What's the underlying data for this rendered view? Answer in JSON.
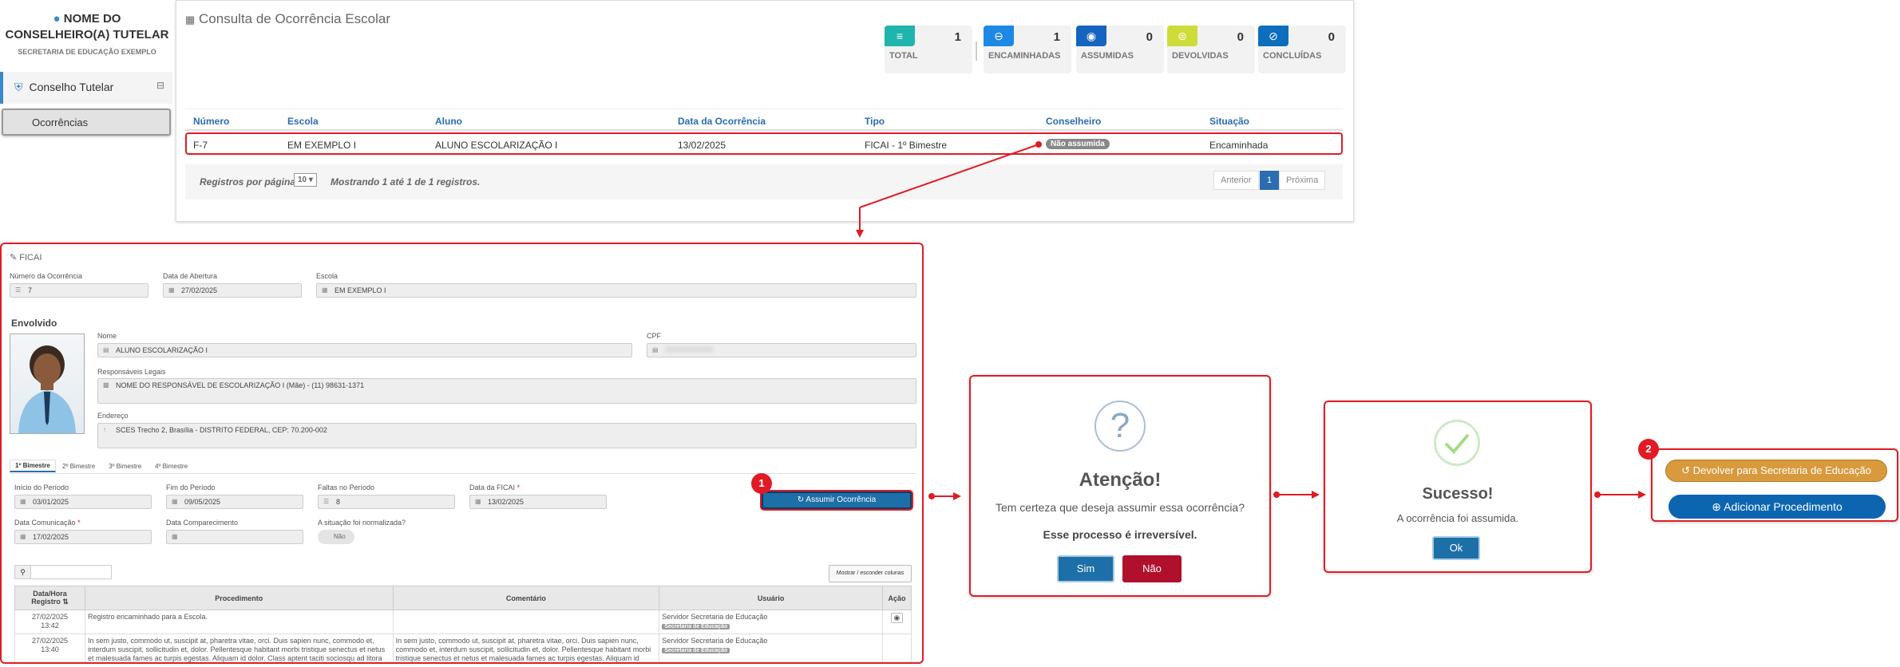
{
  "sidebar": {
    "user_name": "NOME DO CONSELHEIRO(A) TUTELAR",
    "secretaria": "SECRETARIA DE EDUCAÇÃO EXEMPLO",
    "menu": "Conselho Tutelar",
    "submenu": "Ocorrências"
  },
  "header": {
    "title": "Consulta de Ocorrência Escolar"
  },
  "stats": [
    {
      "label": "TOTAL",
      "value": "1",
      "color": "#1fb5ac"
    },
    {
      "label": "ENCAMINHADAS",
      "value": "1",
      "color": "#1e88e5"
    },
    {
      "label": "ASSUMIDAS",
      "value": "0",
      "color": "#1565c0"
    },
    {
      "label": "DEVOLVIDAS",
      "value": "0",
      "color": "#cddc39"
    },
    {
      "label": "CONCLUÍDAS",
      "value": "0",
      "color": "#0d6ebd"
    }
  ],
  "table": {
    "headers": [
      "Número",
      "Escola",
      "Aluno",
      "Data da Ocorrência",
      "Tipo",
      "Conselheiro",
      "Situação"
    ],
    "row": [
      "F-7",
      "EM EXEMPLO I",
      "ALUNO ESCOLARIZAÇÃO I",
      "13/02/2025",
      "FICAI - 1º Bimestre",
      "Não assumida",
      "Encaminhada"
    ],
    "footer_label": "Registros por página:",
    "page_size": "10",
    "footer_text": "Mostrando 1 até 1 de 1 registros.",
    "prev": "Anterior",
    "page": "1",
    "next": "Próxima"
  },
  "form": {
    "title": "FICAI",
    "numero_label": "Número da Ocorrência",
    "numero": "7",
    "abertura_label": "Data de Abertura",
    "abertura": "27/02/2025",
    "escola_label": "Escola",
    "escola": "EM EXEMPLO I",
    "envolvido": "Envolvido",
    "nome_label": "Nome",
    "nome": "ALUNO ESCOLARIZAÇÃO I",
    "cpf_label": "CPF",
    "resp_label": "Responsáveis Legais",
    "resp": "NOME DO RESPONSÁVEL DE ESCOLARIZAÇÃO I (Mãe) - (11) 98631-1371",
    "end_label": "Endereço",
    "end": "SCES Trecho 2, Brasília - DISTRITO FEDERAL, CEP: 70.200-002",
    "tabs": [
      "1º Bimestre",
      "2º Bimestre",
      "3º Bimestre",
      "4º Bimestre"
    ],
    "inicio_label": "Início do Período",
    "inicio": "03/01/2025",
    "fim_label": "Fim do Período",
    "fim": "09/05/2025",
    "faltas_label": "Faltas no Período",
    "faltas": "8",
    "data_ficai_label": "Data da FICAI",
    "data_ficai": "13/02/2025",
    "comunicacao_label": "Data Comunicação",
    "comunicacao": "17/02/2025",
    "comparecimento_label": "Data Comparecimento",
    "normalizada_label": "A situação foi normalizada?",
    "normalizada": "Não",
    "assumir_button": "Assumir Ocorrência",
    "toggle_cols": "Mostrar / esconder colunas",
    "proc_headers": [
      "Data/Hora Registro",
      "Procedimento",
      "Comentário",
      "Usuário",
      "Ação"
    ],
    "proc_rows": [
      {
        "date": "27/02/2025",
        "time": "13:42",
        "proc": "Registro encaminhado para a Escola.",
        "comment": "",
        "user": "Servidor Secretaria de Educação",
        "badge": "Secretaria de Educação"
      },
      {
        "date": "27/02/2025",
        "time": "13:40",
        "proc": "In sem justo, commodo ut, suscipit at, pharetra vitae, orci. Duis sapien nunc, commodo et, interdum suscipit, sollicitudin et, dolor. Pellentesque habitant morbi tristique senectus et netus et malesuada fames ac turpis egestas. Aliquam id dolor. Class aptent taciti sociosqu ad litora torquent per conubia",
        "comment": "In sem justo, commodo ut, suscipit at, pharetra vitae, orci. Duis sapien nunc, commodo et, interdum suscipit, sollicitudin et, dolor. Pellentesque habitant morbi tristique senectus et netus et malesuada fames ac turpis egestas. Aliquam id dolor.",
        "user": "Servidor Secretaria de Educação",
        "badge": "Secretaria de Educação"
      }
    ]
  },
  "confirm": {
    "icon": "?",
    "title": "Atenção!",
    "text": "Tem certeza que deseja assumir essa ocorrência?",
    "bold": "Esse processo é irreversível.",
    "yes": "Sim",
    "no": "Não"
  },
  "success": {
    "title": "Sucesso!",
    "text": "A ocorrência foi assumida.",
    "ok": "Ok"
  },
  "actions": {
    "devolver": "Devolver para Secretaria de Educação",
    "adicionar": "Adicionar Procedimento"
  },
  "steps": [
    "1",
    "2"
  ]
}
